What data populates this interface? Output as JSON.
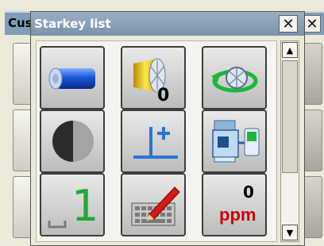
{
  "background_window": {
    "title": "Cus",
    "close_glyph": "✕"
  },
  "dialog": {
    "title": "Starkey list",
    "close_glyph": "✕"
  },
  "keys": [
    {
      "icon": "battery-icon",
      "label": ""
    },
    {
      "icon": "prism-icon",
      "label": "0"
    },
    {
      "icon": "rotate-prism-icon",
      "label": ""
    },
    {
      "icon": "contrast-icon",
      "label": ""
    },
    {
      "icon": "instrument-height-icon",
      "label": ""
    },
    {
      "icon": "total-station-controller-icon",
      "label": ""
    },
    {
      "icon": "face-one-icon",
      "label": "1"
    },
    {
      "icon": "keyboard-pen-icon",
      "label": ""
    },
    {
      "icon": "ppm-icon",
      "label": "0",
      "label2": "ppm"
    }
  ],
  "scrollbar": {
    "up_glyph": "▲",
    "down_glyph": "▼"
  },
  "colors": {
    "titlebar": "#8aa3bb",
    "accent_blue": "#2a74d6",
    "accent_red": "#cc0000",
    "accent_green": "#1bbf3a"
  }
}
